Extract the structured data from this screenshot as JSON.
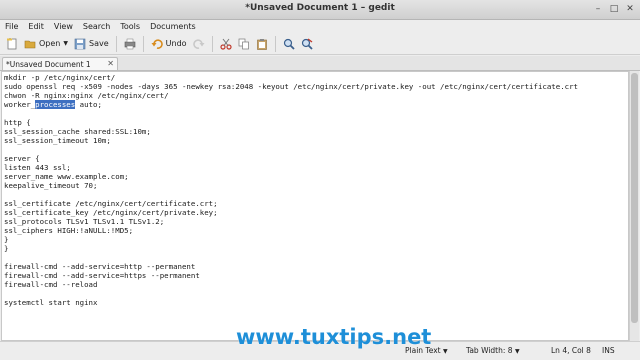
{
  "window": {
    "title": "*Unsaved Document 1 – gedit"
  },
  "menu": [
    "File",
    "Edit",
    "View",
    "Search",
    "Tools",
    "Documents"
  ],
  "toolbar": {
    "open_label": "Open",
    "save_label": "Save",
    "undo_label": "Undo"
  },
  "tab": {
    "label": "*Unsaved Document 1"
  },
  "editor": {
    "lines": [
      "mkdir -p /etc/nginx/cert/",
      "sudo openssl req -x509 -nodes -days 365 -newkey rsa:2048 -keyout /etc/nginx/cert/private.key -out /etc/nginx/cert/certificate.crt",
      "chwon -R nginx:nginx /etc/nginx/cert/",
      "",
      "",
      "http {",
      "ssl_session_cache shared:SSL:10m;",
      "ssl_session_timeout 10m;",
      "",
      "server {",
      "listen 443 ssl;",
      "server_name www.example.com;",
      "keepalive_timeout 70;",
      "",
      "ssl_certificate /etc/nginx/cert/certificate.crt;",
      "ssl_certificate_key /etc/nginx/cert/private.key;",
      "ssl_protocols TLSv1 TLSv1.1 TLSv1.2;",
      "ssl_ciphers HIGH:!aNULL:!MD5;",
      "}",
      "}",
      "",
      "firewall-cmd --add-service=http --permanent",
      "firewall-cmd --add-service=https --permanent",
      "firewall-cmd --reload",
      "",
      "systemctl start nginx"
    ],
    "line4": {
      "before": "worker_",
      "selected": "processes",
      "after": " auto;"
    }
  },
  "status": {
    "mode": "Plain Text",
    "tab_width": "Tab Width: 8",
    "position": "Ln 4, Col 8",
    "insert": "INS"
  },
  "watermark": "www.tuxtips.net",
  "colors": {
    "selection": "#3d6fc1",
    "watermark": "#1e8fd8"
  }
}
